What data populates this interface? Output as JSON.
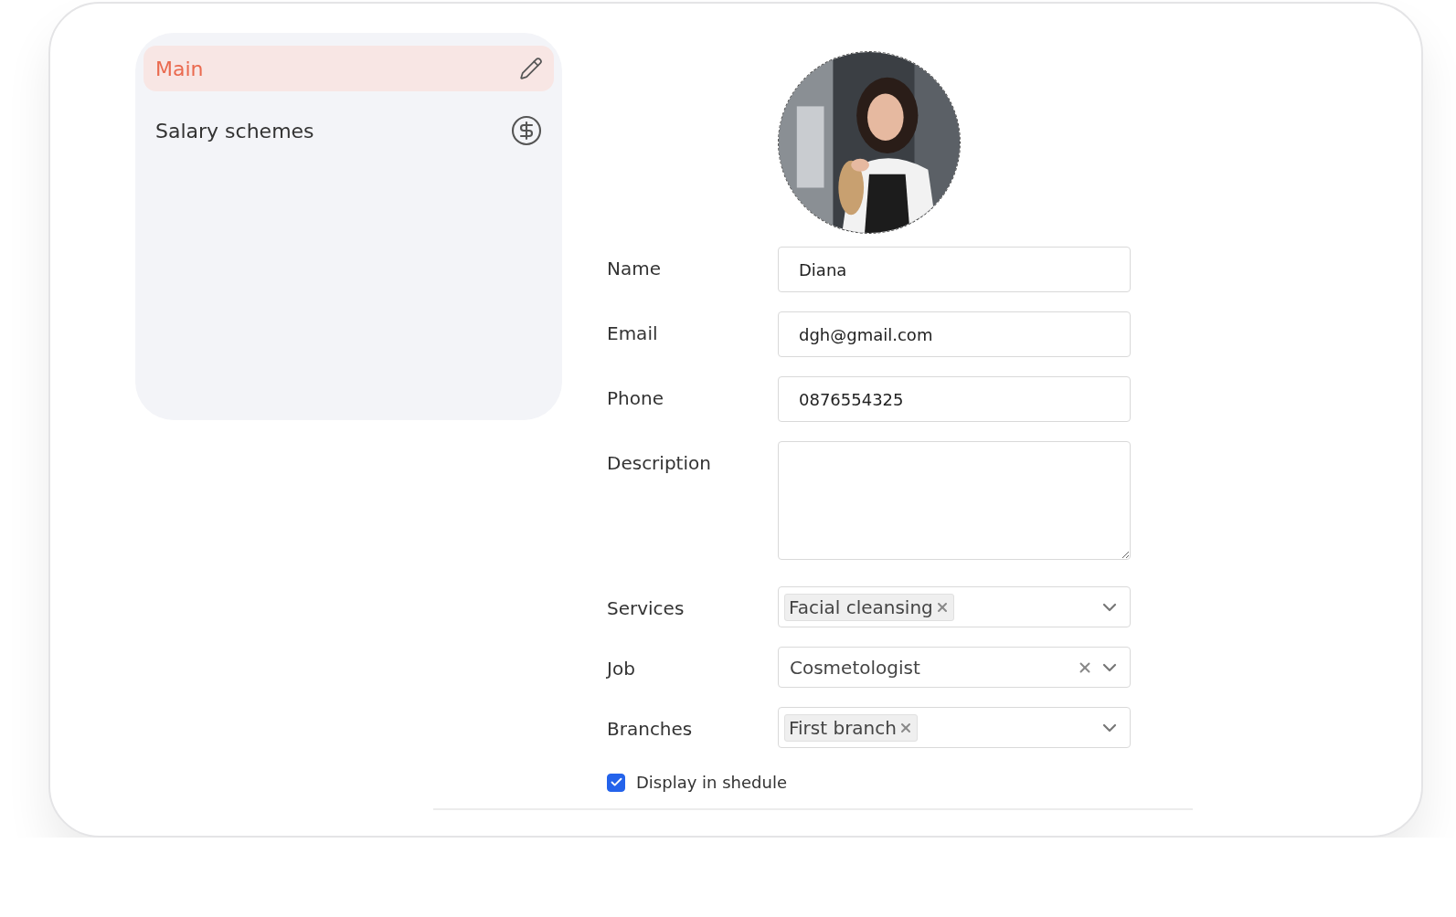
{
  "sidebar": {
    "items": [
      {
        "label": "Main",
        "selected": true,
        "kind": "edit"
      },
      {
        "label": "Salary schemes",
        "selected": false,
        "kind": "salary"
      }
    ]
  },
  "fields": [
    {
      "label": "Name",
      "kind": "text",
      "value": "Diana"
    },
    {
      "label": "Email",
      "kind": "text",
      "value": "dgh@gmail.com"
    },
    {
      "label": "Phone",
      "kind": "text",
      "value": "0876554325"
    },
    {
      "label": "Description",
      "kind": "textarea"
    },
    {
      "label": "Services",
      "kind": "multiselect",
      "tags": [
        "Facial cleansing"
      ]
    },
    {
      "label": "Job",
      "kind": "select",
      "value": "Cosmetologist"
    },
    {
      "label": "Branches",
      "kind": "multiselect",
      "tags": [
        "First branch"
      ]
    }
  ],
  "display_in_schedule": {
    "label": "Display in shedule",
    "checked": true
  }
}
